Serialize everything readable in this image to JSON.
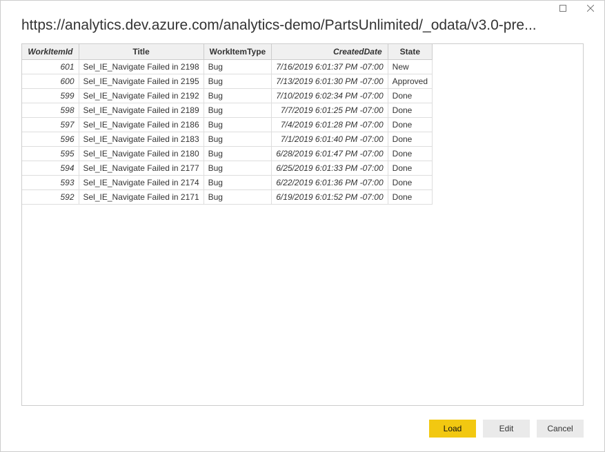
{
  "window": {
    "title_url": "https://analytics.dev.azure.com/analytics-demo/PartsUnlimited/_odata/v3.0-pre..."
  },
  "table": {
    "headers": {
      "workItemId": "WorkItemId",
      "title": "Title",
      "workItemType": "WorkItemType",
      "createdDate": "CreatedDate",
      "state": "State"
    },
    "rows": [
      {
        "workItemId": "601",
        "title": "Sel_IE_Navigate Failed in 2198",
        "workItemType": "Bug",
        "createdDate": "7/16/2019 6:01:37 PM -07:00",
        "state": "New"
      },
      {
        "workItemId": "600",
        "title": "Sel_IE_Navigate Failed in 2195",
        "workItemType": "Bug",
        "createdDate": "7/13/2019 6:01:30 PM -07:00",
        "state": "Approved"
      },
      {
        "workItemId": "599",
        "title": "Sel_IE_Navigate Failed in 2192",
        "workItemType": "Bug",
        "createdDate": "7/10/2019 6:02:34 PM -07:00",
        "state": "Done"
      },
      {
        "workItemId": "598",
        "title": "Sel_IE_Navigate Failed in 2189",
        "workItemType": "Bug",
        "createdDate": "7/7/2019 6:01:25 PM -07:00",
        "state": "Done"
      },
      {
        "workItemId": "597",
        "title": "Sel_IE_Navigate Failed in 2186",
        "workItemType": "Bug",
        "createdDate": "7/4/2019 6:01:28 PM -07:00",
        "state": "Done"
      },
      {
        "workItemId": "596",
        "title": "Sel_IE_Navigate Failed in 2183",
        "workItemType": "Bug",
        "createdDate": "7/1/2019 6:01:40 PM -07:00",
        "state": "Done"
      },
      {
        "workItemId": "595",
        "title": "Sel_IE_Navigate Failed in 2180",
        "workItemType": "Bug",
        "createdDate": "6/28/2019 6:01:47 PM -07:00",
        "state": "Done"
      },
      {
        "workItemId": "594",
        "title": "Sel_IE_Navigate Failed in 2177",
        "workItemType": "Bug",
        "createdDate": "6/25/2019 6:01:33 PM -07:00",
        "state": "Done"
      },
      {
        "workItemId": "593",
        "title": "Sel_IE_Navigate Failed in 2174",
        "workItemType": "Bug",
        "createdDate": "6/22/2019 6:01:36 PM -07:00",
        "state": "Done"
      },
      {
        "workItemId": "592",
        "title": "Sel_IE_Navigate Failed in 2171",
        "workItemType": "Bug",
        "createdDate": "6/19/2019 6:01:52 PM -07:00",
        "state": "Done"
      }
    ]
  },
  "footer": {
    "load_label": "Load",
    "edit_label": "Edit",
    "cancel_label": "Cancel"
  }
}
